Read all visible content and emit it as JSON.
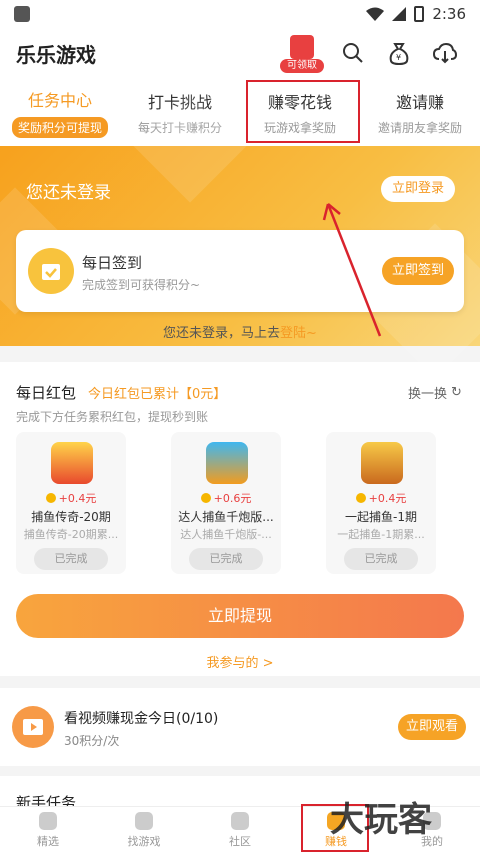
{
  "status": {
    "time": "2:36"
  },
  "header": {
    "title": "乐乐游戏",
    "gift_tag": "可领取"
  },
  "tabs": [
    {
      "label": "任务中心",
      "sub": "奖励积分可提现",
      "active": true
    },
    {
      "label": "打卡挑战",
      "sub": "每天打卡赚积分"
    },
    {
      "label": "赚零花钱",
      "sub": "玩游戏拿奖励"
    },
    {
      "label": "邀请赚",
      "sub": "邀请朋友拿奖励"
    }
  ],
  "banner": {
    "not_logged": "您还未登录",
    "login_btn": "立即登录",
    "sign_title": "每日签到",
    "sign_sub": "完成签到可获得积分~",
    "sign_btn": "立即签到",
    "hint_prefix": "您还未登录，马上去",
    "hint_link": "登陆~"
  },
  "redpack": {
    "title": "每日红包",
    "accum": "今日红包已累计【0元】",
    "switch": "换一换",
    "desc": "完成下方任务累积红包，提现秒到账",
    "games": [
      {
        "reward": "+0.4元",
        "name": "捕鱼传奇-20期",
        "sub": "捕鱼传奇-20期累...",
        "status": "已完成"
      },
      {
        "reward": "+0.6元",
        "name": "达人捕鱼千炮版...",
        "sub": "达人捕鱼千炮版-...",
        "status": "已完成"
      },
      {
        "reward": "+0.4元",
        "name": "一起捕鱼-1期",
        "sub": "一起捕鱼-1期累...",
        "status": "已完成"
      }
    ],
    "withdraw": "立即提现",
    "my_join": "我参与的 >"
  },
  "video_task": {
    "title": "看视频赚现金今日(0/10)",
    "sub": "30积分/次",
    "btn": "立即观看"
  },
  "newbie": {
    "title": "新手任务"
  },
  "bottom_nav": [
    {
      "label": "精选"
    },
    {
      "label": "找游戏"
    },
    {
      "label": "社区"
    },
    {
      "label": "赚钱",
      "active": true
    },
    {
      "label": "我的"
    }
  ],
  "watermark": "大玩客",
  "colors": {
    "accent": "#f59a23",
    "annotation_red": "#d9232d"
  }
}
